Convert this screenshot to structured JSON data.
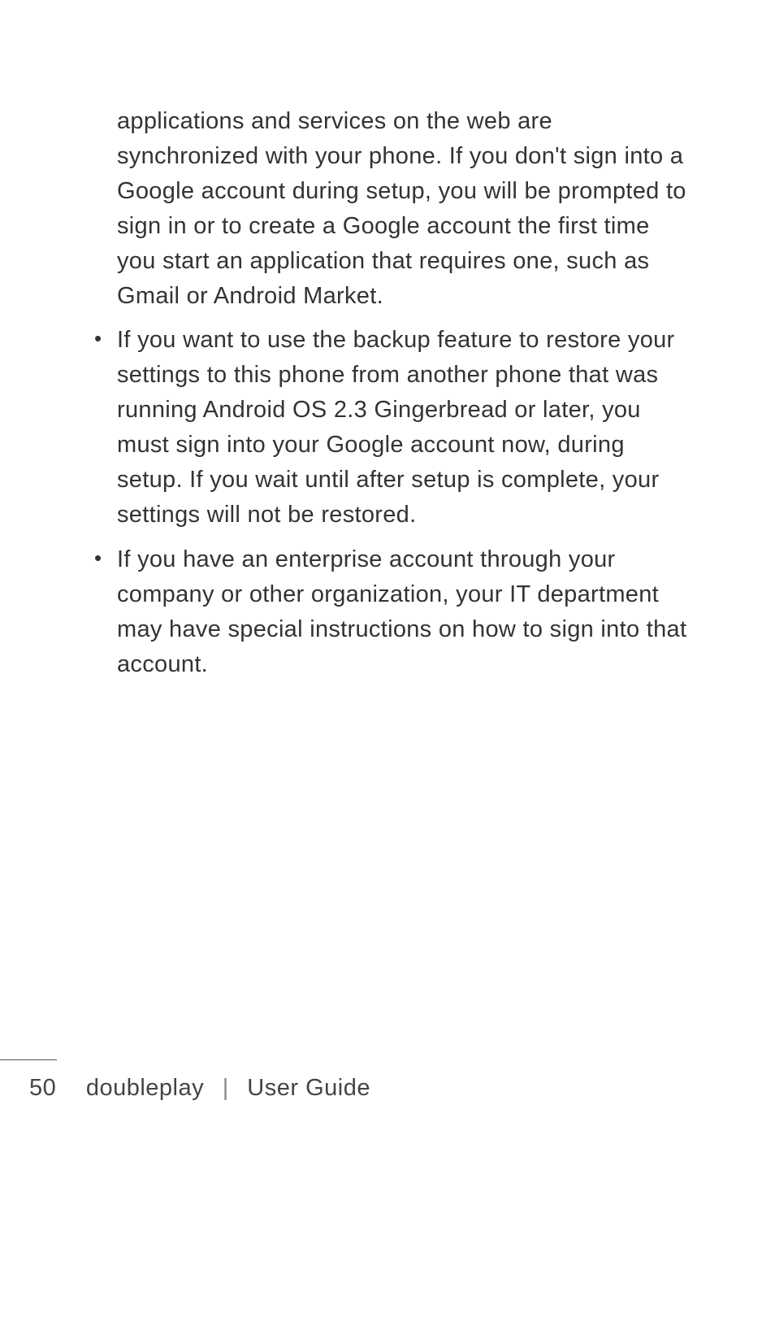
{
  "content": {
    "first_paragraph": "applications and services on the web are synchronized with your phone. If you don't sign into a Google account during setup, you will be prompted to sign in or to create a Google account the first time you start an application that requires one, such as Gmail or Android Market.",
    "bullets": [
      "If you want to use the backup feature to restore your settings to this phone from another phone that was running Android OS 2.3 Gingerbread or later, you must sign into your Google account now, during setup. If you wait until after setup is complete, your settings will not be restored.",
      "If you have an enterprise account through your company or other organization, your IT department may have special instructions on how to sign into that account."
    ]
  },
  "footer": {
    "page_number": "50",
    "product": "doubleplay",
    "separator": "|",
    "guide_label": "User Guide"
  }
}
